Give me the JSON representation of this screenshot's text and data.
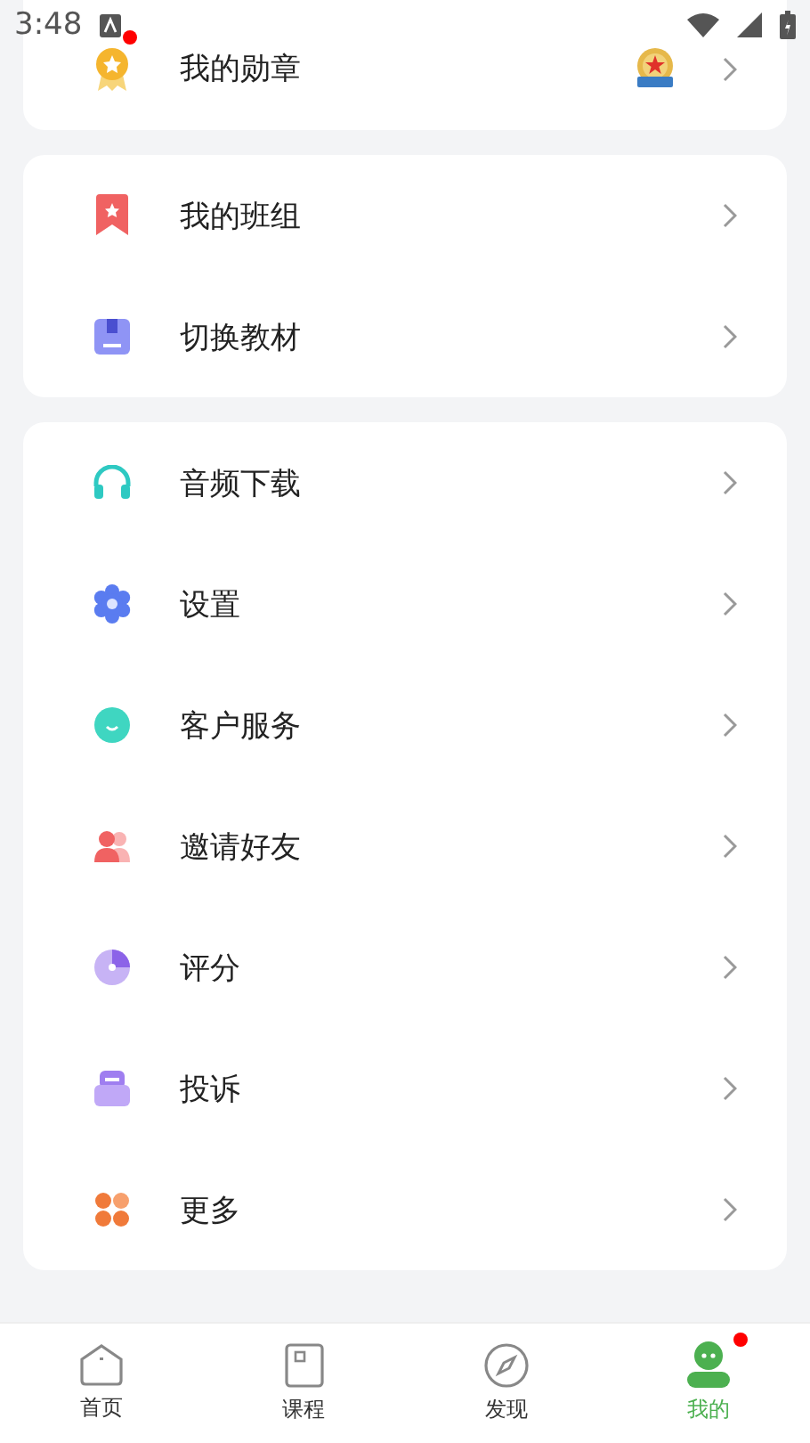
{
  "status_bar": {
    "time": "3:48",
    "notification": true
  },
  "sections": [
    {
      "items": [
        {
          "kind": "medal",
          "label": "我的勋章",
          "has_medal_badge": true
        }
      ]
    },
    {
      "items": [
        {
          "kind": "class",
          "label": "我的班组",
          "has_medal_badge": false
        },
        {
          "kind": "textbook",
          "label": "切换教材",
          "has_medal_badge": false
        }
      ]
    },
    {
      "items": [
        {
          "kind": "audio",
          "label": "音频下载",
          "has_medal_badge": false
        },
        {
          "kind": "settings",
          "label": "设置",
          "has_medal_badge": false
        },
        {
          "kind": "service",
          "label": "客户服务",
          "has_medal_badge": false
        },
        {
          "kind": "invite",
          "label": "邀请好友",
          "has_medal_badge": false
        },
        {
          "kind": "rate",
          "label": "评分",
          "has_medal_badge": false
        },
        {
          "kind": "complaint",
          "label": "投诉",
          "has_medal_badge": false
        },
        {
          "kind": "more",
          "label": "更多",
          "has_medal_badge": false
        }
      ]
    }
  ],
  "tab_bar": [
    {
      "kind": "home",
      "label": "首页",
      "selected": false,
      "dot": false
    },
    {
      "kind": "course",
      "label": "课程",
      "selected": false,
      "dot": false
    },
    {
      "kind": "discover",
      "label": "发现",
      "selected": false,
      "dot": false
    },
    {
      "kind": "mine",
      "label": "我的",
      "selected": true,
      "dot": true
    }
  ]
}
